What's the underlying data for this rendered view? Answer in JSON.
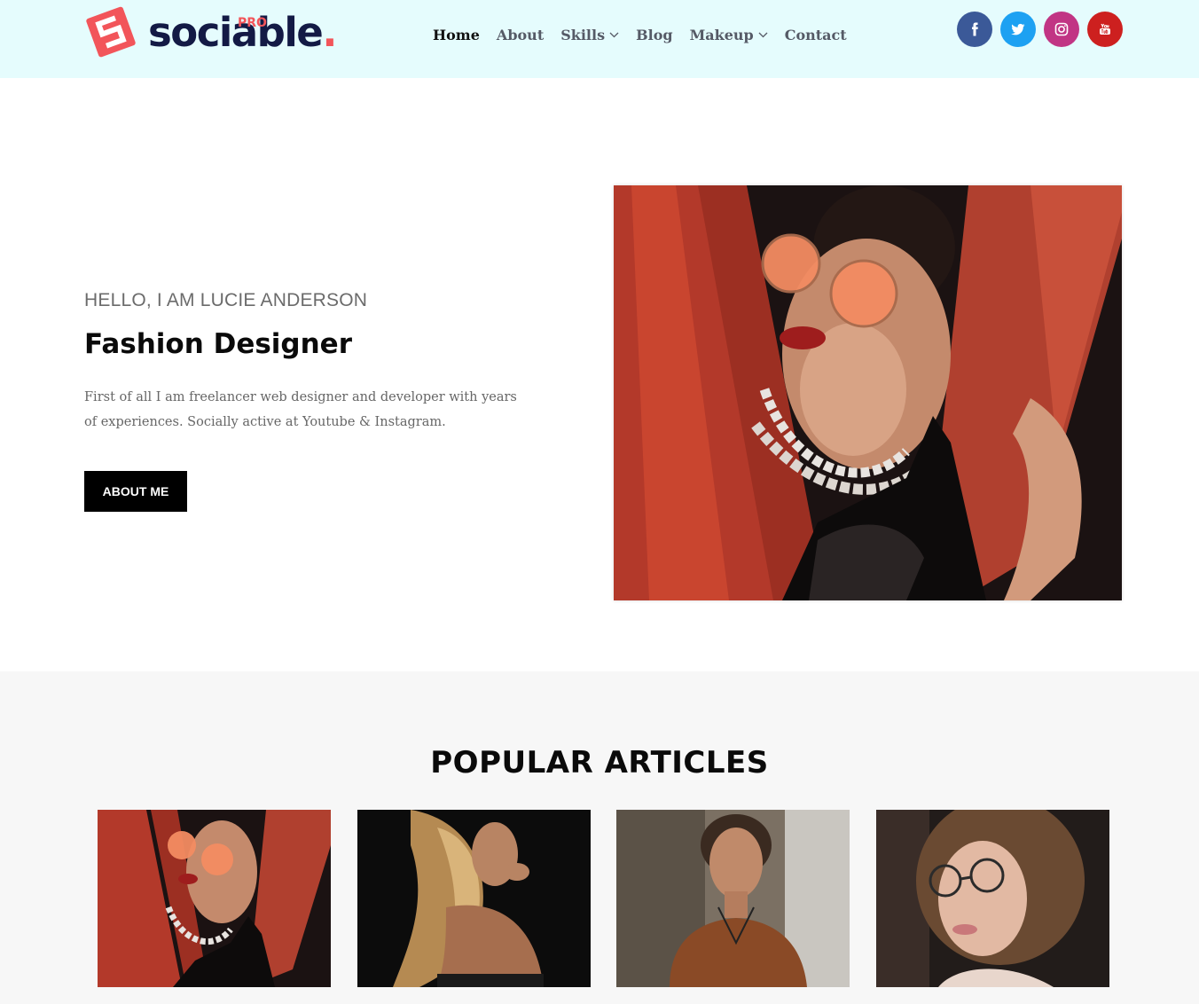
{
  "brand": {
    "name": "sociable",
    "dot": ".",
    "badge": "PRO"
  },
  "nav": [
    {
      "label": "Home",
      "active": true,
      "dropdown": false
    },
    {
      "label": "About",
      "active": false,
      "dropdown": false
    },
    {
      "label": "Skills",
      "active": false,
      "dropdown": true
    },
    {
      "label": "Blog",
      "active": false,
      "dropdown": false
    },
    {
      "label": "Makeup",
      "active": false,
      "dropdown": true
    },
    {
      "label": "Contact",
      "active": false,
      "dropdown": false
    }
  ],
  "socials": [
    {
      "name": "facebook",
      "icon": "facebook-icon",
      "color": "#3b5998"
    },
    {
      "name": "twitter",
      "icon": "twitter-icon",
      "color": "#1da1f2"
    },
    {
      "name": "instagram",
      "icon": "instagram-icon",
      "color": "#c13584"
    },
    {
      "name": "youtube",
      "icon": "youtube-icon",
      "color": "#cd201f"
    }
  ],
  "hero": {
    "greeting": "HELLO, I AM LUCIE ANDERSON",
    "title": "Fashion Designer",
    "description": "First of all I am freelancer web designer and developer with years of experiences. Socially active at Youtube & Instagram.",
    "button_label": "ABOUT ME"
  },
  "articles": {
    "heading": "POPULAR ARTICLES"
  },
  "colors": {
    "header_bg": "#e5fcfd",
    "brand_navy": "#131a45",
    "brand_coral": "#f2555a",
    "section_bg": "#f7f7f7"
  }
}
